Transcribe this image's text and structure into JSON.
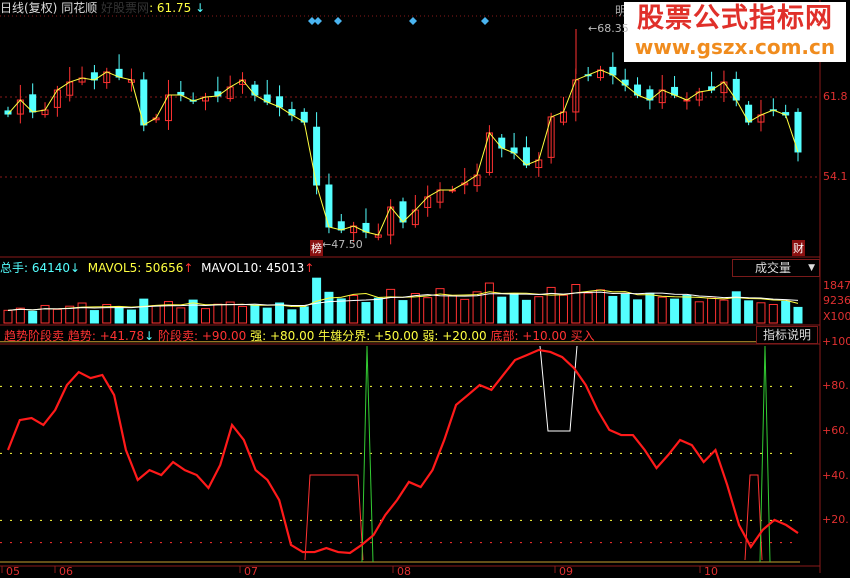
{
  "header": {
    "period": "日线(复权)",
    "stock_name": "同花顺",
    "faded_label": "好股票网",
    "price_label": ": 61.75",
    "price_arrow": "↓"
  },
  "watermark": {
    "title": "股票公式指标网",
    "url": "www.gszx.com.cn"
  },
  "price_panel": {
    "high_label": "68.35",
    "low_label": "47.50",
    "axis_labels": [
      "61.8",
      "54.1"
    ],
    "badge_left": "榜",
    "badge_right": "财",
    "top_tab_partial": "明"
  },
  "volume_panel": {
    "total_label": "总手: ",
    "total_value": "64140",
    "total_arrow": "↓",
    "mavol5_label": "MAVOL5: ",
    "mavol5_value": "50656",
    "mavol5_arrow": "↑",
    "mavol10_label": "MAVOL10: ",
    "mavol10_value": "45013",
    "mavol10_arrow": "↑",
    "selector": "成交量",
    "axis_labels": [
      "1847",
      "9236",
      "X100"
    ]
  },
  "indicator_panel": {
    "name": "趋势阶段卖",
    "trend_label": "趋势: ",
    "trend_value": "+41.78",
    "trend_arrow": "↓",
    "stage_sell": "阶段卖: +90.00",
    "strong": "强: +80.00",
    "bull_bear": "牛雄分界: +50.00",
    "weak": "弱: +20.00",
    "bottom": "底部: +10.00",
    "buy": "买入",
    "help_button": "指标说明",
    "axis_labels": [
      "+100",
      "+80.",
      "+60.",
      "+40.",
      "+20."
    ]
  },
  "time_axis": [
    "05",
    "06",
    "07",
    "08",
    "09",
    "10"
  ],
  "colors": {
    "up": "#ff3232",
    "down": "#54ffff",
    "ma": "#ffff40",
    "trend": "#ff1a1a",
    "grid": "#8a1a1a"
  },
  "chart_data": [
    {
      "type": "candlestick",
      "price_axis": [
        54.1,
        61.8
      ],
      "high": 68.35,
      "low": 47.5,
      "close": [
        60.16,
        61.51,
        60.36,
        60.55,
        62.47,
        63.24,
        63.63,
        63.44,
        64.21,
        63.72,
        63.44,
        59.11,
        59.78,
        61.99,
        61.99,
        61.42,
        61.8,
        61.9,
        62.76,
        63.44,
        61.99,
        61.32,
        60.84,
        60.07,
        59.39,
        53.33,
        49.29,
        49.0,
        49.38,
        48.81,
        48.52,
        51.21,
        49.77,
        50.92,
        52.18,
        52.85,
        52.85,
        53.52,
        54.29,
        58.34,
        56.89,
        56.41,
        55.26,
        55.74,
        59.88,
        60.36,
        63.44,
        63.92,
        64.4,
        63.92,
        62.95,
        61.99,
        61.51,
        62.47,
        61.99,
        61.51,
        62.28,
        62.47,
        63.24,
        61.51,
        59.39,
        60.07,
        60.55,
        60.07,
        56.51
      ]
    },
    {
      "type": "bar",
      "name": "成交量",
      "values": [
        5200,
        6100,
        4800,
        7200,
        5600,
        6900,
        8200,
        5100,
        7600,
        6400,
        5300,
        9800,
        7100,
        8800,
        6200,
        9400,
        5900,
        7700,
        8600,
        6800,
        7300,
        6100,
        8200,
        5400,
        6600,
        18400,
        12600,
        9900,
        11300,
        8400,
        10200,
        13800,
        9200,
        12100,
        10400,
        14100,
        11200,
        9700,
        12800,
        16400,
        10600,
        11900,
        9300,
        10800,
        14600,
        11400,
        15800,
        12300,
        13600,
        10900,
        11700,
        9500,
        12200,
        10600,
        9800,
        11300,
        8700,
        10200,
        9400,
        12800,
        9100,
        8300,
        7600,
        8900,
        6400
      ],
      "axis": [
        0,
        18470
      ]
    },
    {
      "type": "line",
      "name": "趋势",
      "range": [
        0,
        100
      ],
      "levels": [
        100,
        80,
        50,
        20,
        10
      ],
      "values": [
        51.5,
        64.9,
        65.8,
        62.7,
        69.4,
        80.6,
        86.4,
        83.7,
        85.1,
        76.1,
        51.5,
        38.1,
        42.5,
        40.3,
        46.1,
        42.5,
        40.3,
        34.5,
        44.8,
        62.7,
        56.0,
        42.5,
        38.1,
        29.1,
        9.0,
        5.8,
        5.8,
        7.6,
        5.8,
        5.4,
        9.0,
        13.4,
        22.4,
        29.1,
        37.2,
        34.9,
        42.5,
        56.0,
        71.7,
        76.1,
        80.6,
        78.4,
        85.1,
        91.8,
        94.0,
        96.3,
        95.4,
        93.1,
        88.2,
        80.6,
        69.4,
        60.5,
        58.2,
        58.2,
        51.5,
        43.4,
        49.3,
        56.0,
        53.7,
        46.1,
        51.5,
        35.8,
        17.9,
        8.1,
        15.7,
        20.2,
        17.9,
        14.3
      ]
    }
  ]
}
